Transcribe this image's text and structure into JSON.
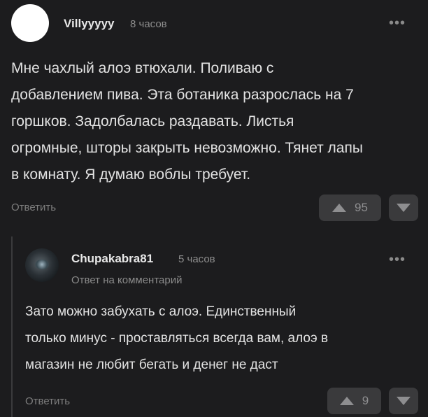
{
  "comment": {
    "username": "Villyyyyy",
    "time": "8 часов",
    "more": "•••",
    "lines": [
      "Мне чахлый алоэ втюхали. Поливаю с",
      "добавлением пива. Эта ботаника разрослась на 7",
      "горшков. Задолбалась раздавать. Листья",
      "огромные, шторы закрыть невозможно. Тянет лапы",
      "в комнату. Я думаю воблы требует."
    ],
    "reply_label": "Ответить",
    "votes": "95"
  },
  "reply": {
    "username": "Chupakabra81",
    "time": "5 часов",
    "more": "•••",
    "subtitle": "Ответ на комментарий",
    "lines": [
      "Зато можно забухать с алоэ. Единственный",
      "только минус - проставляться всегда вам, алоэ в",
      "магазин не любит бегать и денег не даст"
    ],
    "reply_label": "Ответить",
    "votes": "9"
  }
}
